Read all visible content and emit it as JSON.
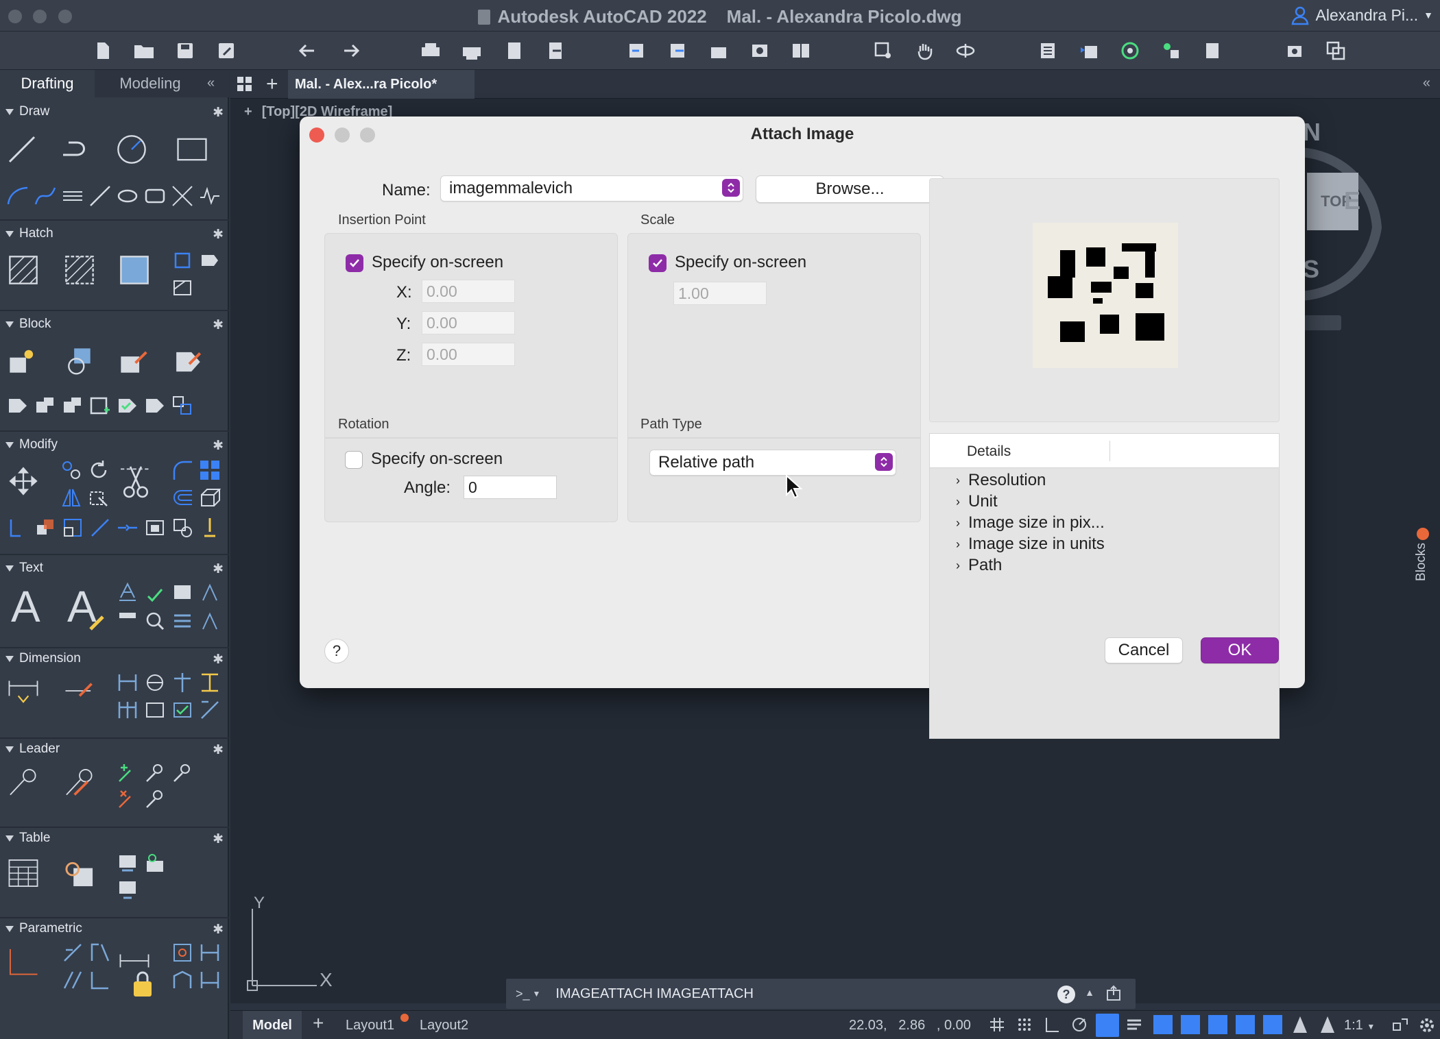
{
  "window": {
    "title": "Autodesk AutoCAD 2022    Mal. - Alexandra Picolo.dwg",
    "user": "Alexandra Pi..."
  },
  "workspace_tabs": [
    "Drafting",
    "Modeling"
  ],
  "palette_sections": [
    "Draw",
    "Hatch",
    "Block",
    "Modify",
    "Text",
    "Dimension",
    "Leader",
    "Table",
    "Parametric"
  ],
  "document": {
    "tab_label": "Mal. - Alex...ra Picolo*",
    "viewport_label": "[Top][2D Wireframe]",
    "viewcube": {
      "top_face": "TOP",
      "east": "E",
      "north": "N",
      "south": "S"
    },
    "ucs_x": "X",
    "ucs_y": "Y",
    "blocks_label": "Blocks"
  },
  "command_line": {
    "prompt": ">_",
    "text": "IMAGEATTACH IMAGEATTACH"
  },
  "status_bar": {
    "model_tab": "Model",
    "layouts": [
      "Layout1",
      "Layout2"
    ],
    "coords": "22.03,   2.86   , 0.00",
    "scale": "1:1"
  },
  "dialog": {
    "title": "Attach Image",
    "name_label": "Name:",
    "name_value": "imagemmalevich",
    "browse_label": "Browse...",
    "insertion": {
      "label": "Insertion Point",
      "specify": "Specify on-screen",
      "checked": true,
      "x_label": "X:",
      "x_value": "0.00",
      "y_label": "Y:",
      "y_value": "0.00",
      "z_label": "Z:",
      "z_value": "0.00"
    },
    "scale": {
      "label": "Scale",
      "specify": "Specify on-screen",
      "checked": true,
      "value": "1.00"
    },
    "rotation": {
      "label": "Rotation",
      "specify": "Specify on-screen",
      "checked": false,
      "angle_label": "Angle:",
      "angle_value": "0"
    },
    "path_type": {
      "label": "Path Type",
      "value": "Relative path"
    },
    "details": {
      "header": "Details",
      "items": [
        "Resolution",
        "Unit",
        "Image size in pix...",
        "Image size in units",
        "Path"
      ]
    },
    "help_label": "?",
    "cancel_label": "Cancel",
    "ok_label": "OK"
  },
  "colors": {
    "accent": "#8e2ca8",
    "close_dot": "#ee5b51",
    "badge": "#e9683a"
  }
}
